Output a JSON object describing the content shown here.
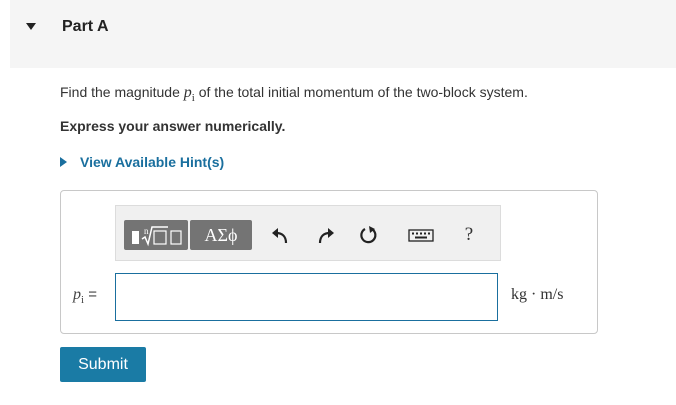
{
  "part": {
    "title": "Part A"
  },
  "question": {
    "prefix": "Find the magnitude ",
    "var_symbol": "p",
    "var_subscript": "i",
    "suffix": " of the total initial momentum of the two-block system."
  },
  "instruction": "Express your answer numerically.",
  "hint": {
    "label": "View Available Hint(s)"
  },
  "toolbar": {
    "templates_icon": "templates-icon",
    "greek_label": "ΑΣϕ",
    "undo_icon": "undo-icon",
    "redo_icon": "redo-icon",
    "reset_icon": "reset-icon",
    "keyboard_icon": "keyboard-icon",
    "help_label": "?"
  },
  "answer": {
    "var_symbol": "p",
    "var_subscript": "i",
    "equals": " =",
    "value": "",
    "units": "kg · m/s"
  },
  "submit": {
    "label": "Submit"
  },
  "colors": {
    "accent": "#1a7ba5",
    "link": "#1a6f9e",
    "toolbar_button": "#747474",
    "header_bg": "#f5f5f5"
  }
}
